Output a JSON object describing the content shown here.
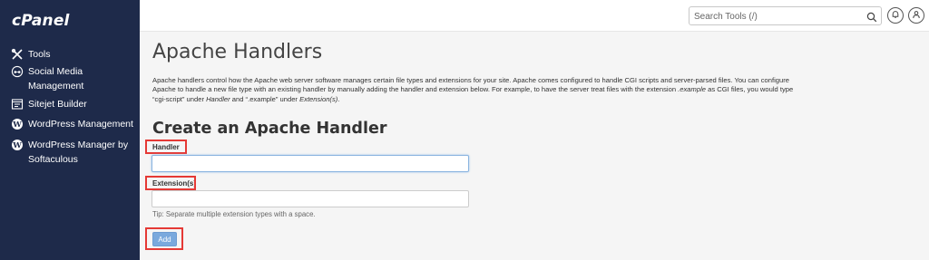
{
  "brand": {
    "name": "cPanel"
  },
  "sidebar": {
    "items": [
      {
        "label": "Tools",
        "icon": "tools-icon"
      },
      {
        "label": "Social Media Management",
        "icon": "social-media-icon"
      },
      {
        "label": "Sitejet Builder",
        "icon": "sitejet-icon"
      },
      {
        "label": "WordPress Management",
        "icon": "wordpress-icon"
      },
      {
        "label": "WordPress Manager by Softaculous",
        "icon": "wordpress-icon"
      }
    ]
  },
  "header": {
    "search_placeholder": "Search Tools (/)",
    "icons": [
      "search-icon",
      "bell-icon",
      "user-icon"
    ]
  },
  "page": {
    "title": "Apache Handlers",
    "description": {
      "p1": "Apache handlers control how the Apache web server software manages certain file types and extensions for your site. Apache comes configured to handle CGI scripts and server-parsed files. You can configure Apache to handle a new file type with an existing handler by manually adding the handler and extension below. For example, to have the server treat files with the extension ",
      "ext": ".example",
      "p2": " as CGI files, you would type “cgi-script” under ",
      "handler_word": "Handler",
      "p3": " and “.example” under ",
      "ext_word": "Extension(s)",
      "p4": "."
    }
  },
  "form": {
    "section_title": "Create an Apache Handler",
    "handler_label": "Handler",
    "handler_value": "",
    "extensions_label": "Extension(s)",
    "extensions_value": "",
    "tip": "Tip: Separate multiple extension types with a space.",
    "add_label": "Add"
  },
  "colors": {
    "sidebar_bg": "#1e2a4a",
    "highlight": "#e53935",
    "button_bg": "#7aa9dd"
  }
}
